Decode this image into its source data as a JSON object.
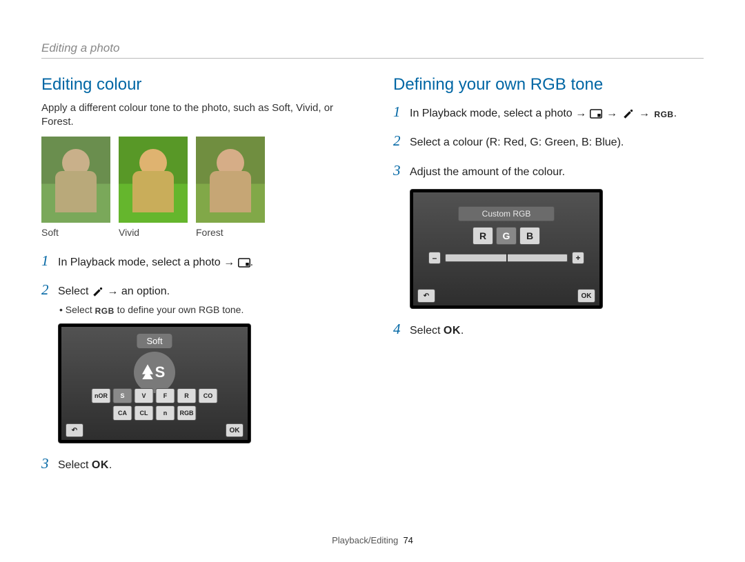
{
  "header": {
    "breadcrumb": "Editing a photo"
  },
  "left": {
    "title": "Editing colour",
    "intro": "Apply a different colour tone to the photo, such as Soft, Vivid, or Forest.",
    "thumbs": [
      "Soft",
      "Vivid",
      "Forest"
    ],
    "steps": {
      "s1_a": "In Playback mode, select a photo →",
      "s1_period": ".",
      "s2_a": "Select",
      "s2_b": "→ an option.",
      "s2_sub_a": "Select",
      "s2_sub_b": "to define your own RGB tone.",
      "s3_a": "Select",
      "s3_ok": "OK",
      "s3_period": "."
    },
    "lcd": {
      "bubble": "Soft",
      "big_letter": "S",
      "row1": [
        "nOR",
        "S",
        "V",
        "F",
        "R",
        "CO"
      ],
      "row2": [
        "CA",
        "CL",
        "n",
        "RGB"
      ],
      "back": "↶",
      "ok": "OK"
    }
  },
  "right": {
    "title": "Defining your own RGB tone",
    "steps": {
      "s1_a": "In Playback mode, select a photo →",
      "s1_arrow": "→",
      "s1_rgb": "RGB",
      "s1_period": ".",
      "s2": "Select a colour (R: Red, G: Green, B: Blue).",
      "s3": "Adjust the amount of the colour.",
      "s4_a": "Select",
      "s4_ok": "OK",
      "s4_period": "."
    },
    "lcd": {
      "title": "Custom RGB",
      "letters": [
        "R",
        "G",
        "B"
      ],
      "minus": "–",
      "plus": "+",
      "back": "↶",
      "ok": "OK"
    }
  },
  "footer": {
    "section": "Playback/Editing",
    "page": "74"
  }
}
